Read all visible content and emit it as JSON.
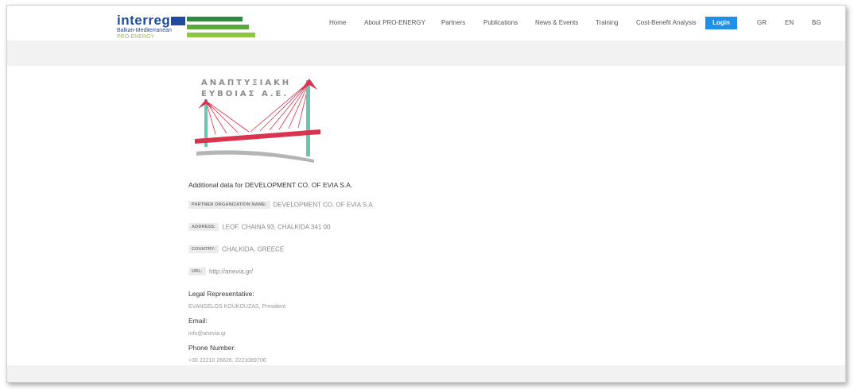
{
  "header": {
    "logo": {
      "brand": "interreg",
      "line1": "Balkan-Mediterranean",
      "line2": "PRO-ENERGY"
    },
    "nav": [
      {
        "label": "Home",
        "name": "nav-home"
      },
      {
        "label": "About PRO-ENERGY",
        "name": "nav-about"
      },
      {
        "label": "Partners",
        "name": "nav-partners"
      },
      {
        "label": "Publications",
        "name": "nav-publications"
      },
      {
        "label": "News & Events",
        "name": "nav-news-events"
      },
      {
        "label": "Training",
        "name": "nav-training"
      },
      {
        "label": "Cost-Benefit Analysis",
        "name": "nav-cost-benefit"
      }
    ],
    "login_label": "Login",
    "languages": [
      "GR",
      "EN",
      "BG"
    ]
  },
  "partner": {
    "logo_title_line1": "ΑΝΑΠΤΥΞΙΑΚΗ",
    "logo_title_line2": "ΕΥΒΟΙΑΣ Α.Ε.",
    "heading": "Additional data for DEVELOPMENT CO. OF EVIA S.A.",
    "fields": [
      {
        "tag": "PARTNER ORGANIZATION NAME:",
        "value": "DEVELOPMENT CO. OF EVIA S.A"
      },
      {
        "tag": "ADDRESS:",
        "value": "LEOF. CHAINA 93, CHALKIDA 341 00"
      },
      {
        "tag": "COUNTRY:",
        "value": "CHALKIDA, GREECE"
      },
      {
        "tag": "URL:",
        "value": "http://anevia.gr/"
      }
    ],
    "legal_rep_label": "Legal Representative:",
    "legal_rep_value": "EVANGELOS KOUKOUZAS, President",
    "email_label": "Email:",
    "email_value": "info@anevia.gr",
    "phone_label": "Phone Number:",
    "phone_value": "+30 22210 26626, 2221089706"
  },
  "colors": {
    "brand_blue": "#1f4aa0",
    "login_blue": "#1e90e8",
    "bridge_red": "#d9334f",
    "bridge_teal": "#6cc3b0",
    "bridge_grey": "#b5b5b5"
  }
}
